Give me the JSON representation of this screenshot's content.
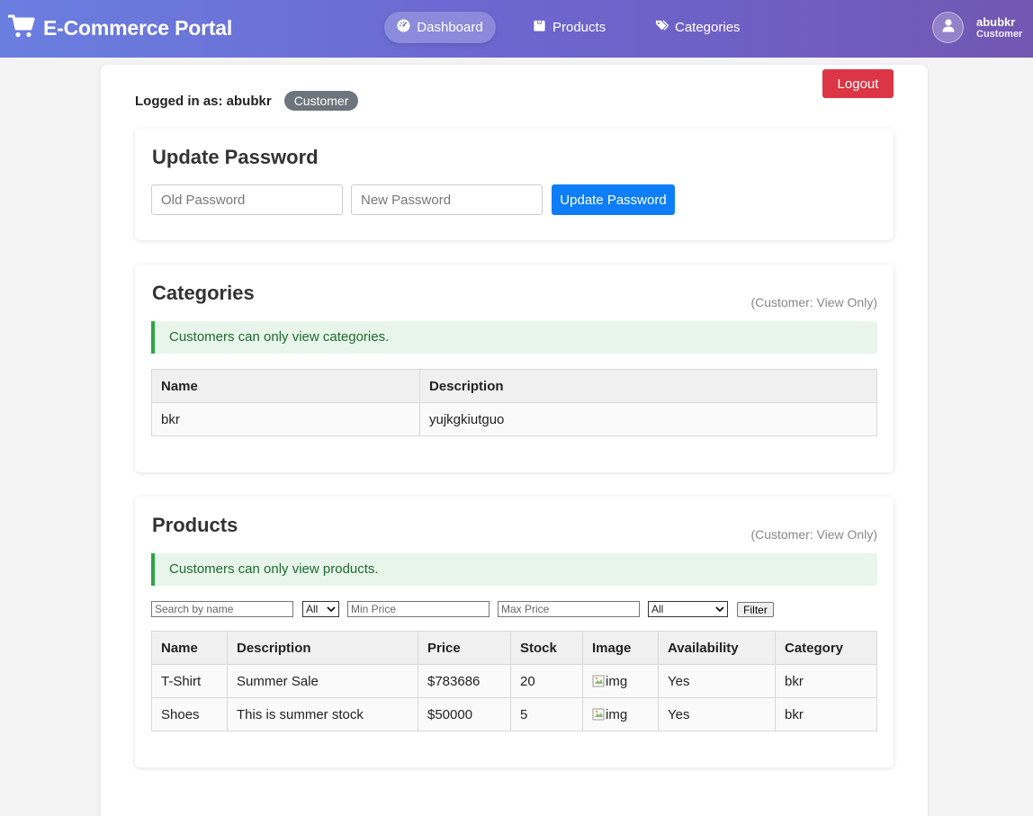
{
  "nav": {
    "brand": "E-Commerce Portal",
    "items": [
      {
        "label": "Dashboard",
        "icon": "dashboard-icon"
      },
      {
        "label": "Products",
        "icon": "box-icon"
      },
      {
        "label": "Categories",
        "icon": "tags-icon"
      }
    ],
    "user": {
      "name": "abubkr",
      "role": "Customer"
    }
  },
  "session": {
    "logged_in_label": "Logged in as: abubkr",
    "role_badge": "Customer",
    "logout_label": "Logout"
  },
  "password": {
    "title": "Update Password",
    "old_placeholder": "Old Password",
    "new_placeholder": "New Password",
    "button": "Update Password"
  },
  "categories": {
    "title": "Categories",
    "view_only": "(Customer: View Only)",
    "notice": "Customers can only view categories.",
    "headers": [
      "Name",
      "Description"
    ],
    "rows": [
      {
        "name": "bkr",
        "description": "yujkgkiutguo"
      }
    ]
  },
  "products": {
    "title": "Products",
    "view_only": "(Customer: View Only)",
    "notice": "Customers can only view products.",
    "filters": {
      "search_placeholder": "Search by name",
      "category_select": "All",
      "min_price_placeholder": "Min Price",
      "max_price_placeholder": "Max Price",
      "availability_select": "All",
      "button": "Filter"
    },
    "headers": [
      "Name",
      "Description",
      "Price",
      "Stock",
      "Image",
      "Availability",
      "Category"
    ],
    "rows": [
      {
        "name": "T-Shirt",
        "description": "Summer Sale",
        "price": "$783686",
        "stock": "20",
        "image_alt": "img",
        "availability": "Yes",
        "category": "bkr"
      },
      {
        "name": "Shoes",
        "description": "This is summer stock",
        "price": "$50000",
        "stock": "5",
        "image_alt": "img",
        "availability": "Yes",
        "category": "bkr"
      }
    ]
  },
  "colors": {
    "nav_gradient_start": "#6a7ee0",
    "nav_gradient_end": "#7257b3",
    "logout": "#dc3545",
    "primary": "#0d7ef7",
    "badge": "#6c757d",
    "notice_bg": "#e8f5ea",
    "notice_border": "#28a745"
  }
}
